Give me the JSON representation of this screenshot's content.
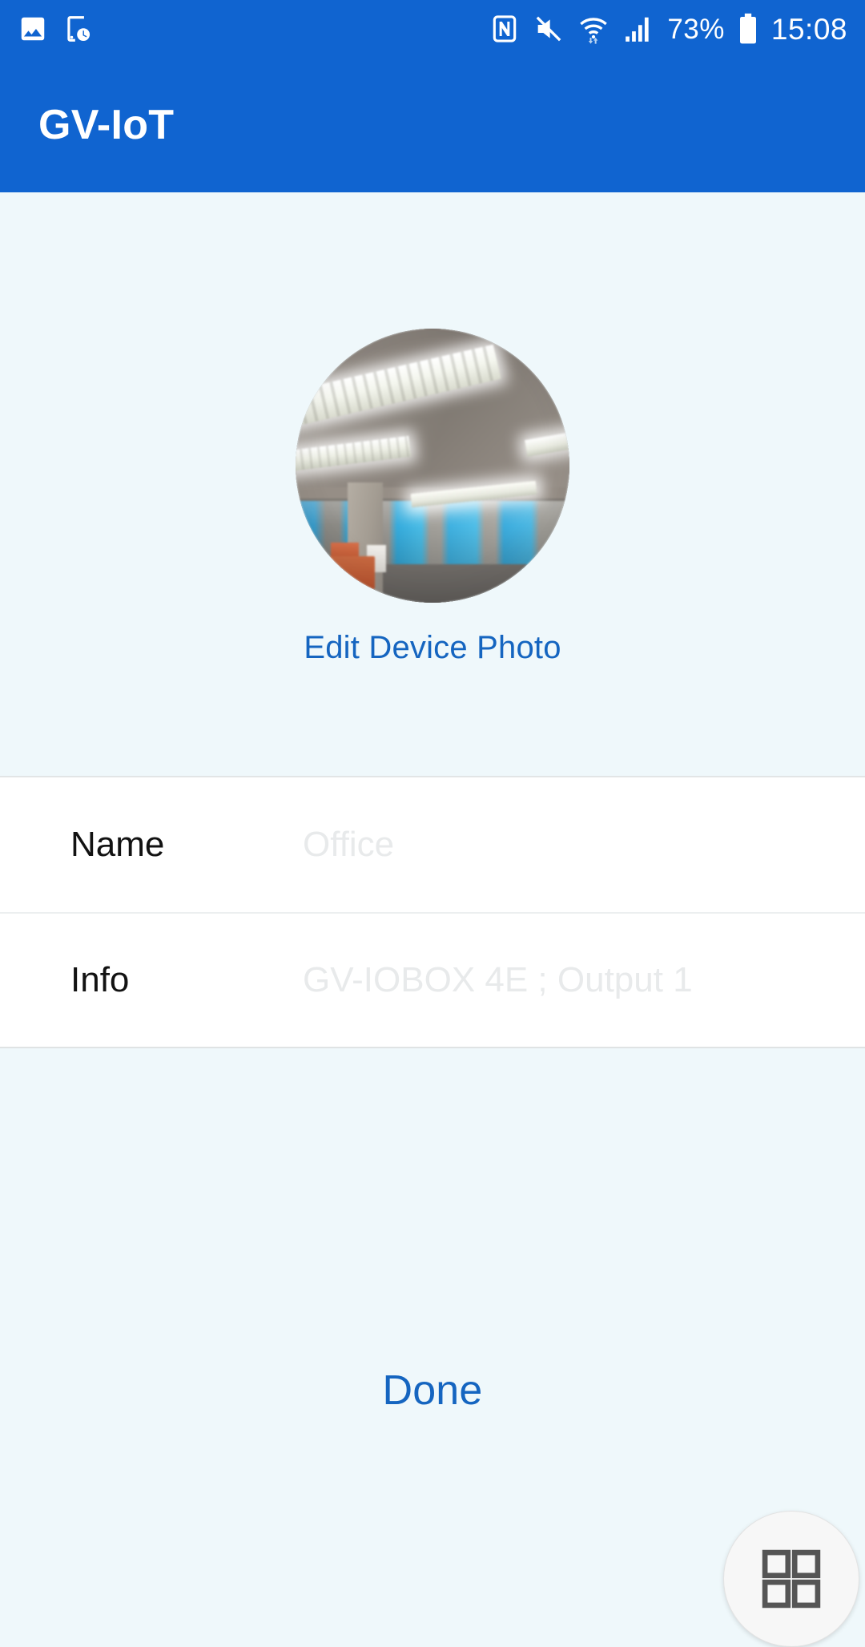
{
  "status_bar": {
    "left_icons": [
      "image-icon",
      "device-clock-icon"
    ],
    "right_icons": [
      "nfc-icon",
      "mute-icon",
      "wifi-icon",
      "signal-icon",
      "battery-icon"
    ],
    "battery_percent": "73%",
    "clock": "15:08"
  },
  "app_bar": {
    "title": "GV-IoT"
  },
  "device_photo": {
    "alt": "office-ceiling-photo",
    "edit_link": "Edit Device Photo"
  },
  "form": {
    "rows": [
      {
        "label": "Name",
        "value": "",
        "placeholder": "Office"
      },
      {
        "label": "Info",
        "value": "",
        "placeholder": "GV-IOBOX 4E ; Output 1"
      }
    ]
  },
  "actions": {
    "done_label": "Done",
    "fab_icon": "grid-icon"
  },
  "colors": {
    "primary_blue": "#1064d0",
    "link_blue": "#1565c0",
    "page_background": "#eff8fb",
    "card_background": "#ffffff",
    "placeholder_gray": "#e8eaeb"
  }
}
